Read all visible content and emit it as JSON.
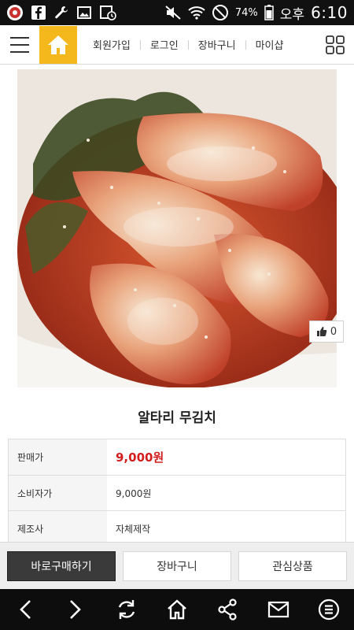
{
  "status_bar": {
    "battery_percent": "74%",
    "ampm": "오후",
    "time": "6:10",
    "icons": [
      "app-icon",
      "facebook-icon",
      "wrench-icon",
      "image-icon",
      "calendar-clock-icon",
      "mute-icon",
      "wifi-icon",
      "do-not-disturb-icon",
      "battery-icon"
    ]
  },
  "topnav": {
    "menu_icon": "hamburger-icon",
    "home_icon": "home-icon",
    "links": [
      "회원가입",
      "로그인",
      "장바구니",
      "마이샵"
    ],
    "grid_icon": "grid-icon"
  },
  "product": {
    "name": "알타리 무김치",
    "like_count": "0",
    "info": [
      {
        "label": "판매가",
        "value": "9,000원"
      },
      {
        "label": "소비자가",
        "value": "9,000원"
      },
      {
        "label": "제조사",
        "value": "자체제작"
      }
    ]
  },
  "actions": {
    "buy_now": "바로구매하기",
    "cart": "장바구니",
    "wishlist": "관심상품"
  },
  "bottom_nav": {
    "icons": [
      "back-icon",
      "forward-icon",
      "refresh-icon",
      "home-icon",
      "share-icon",
      "mail-icon",
      "menu-icon"
    ]
  },
  "colors": {
    "accent": "#f5b81c",
    "price": "#d21e1e",
    "primary_button": "#3a3a3a",
    "status_bar": "#111111"
  }
}
